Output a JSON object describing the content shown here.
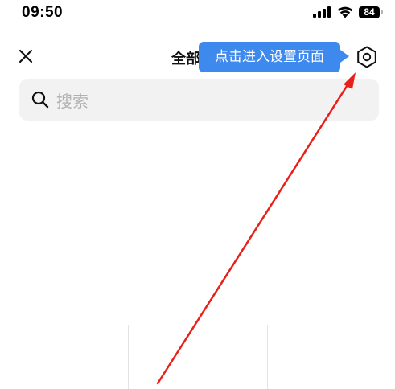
{
  "status_bar": {
    "time": "09:50",
    "battery_level": "84",
    "icons": [
      "signal-icon",
      "wifi-icon",
      "battery-icon"
    ]
  },
  "header": {
    "title": "全部",
    "close_icon": "close-icon",
    "settings_icon": "gear-icon"
  },
  "tooltip": {
    "text": "点击进入设置页面",
    "color": "#3d89ee"
  },
  "search": {
    "placeholder": "搜索",
    "icon": "search-icon"
  },
  "annotation": {
    "color": "#e8201a"
  }
}
